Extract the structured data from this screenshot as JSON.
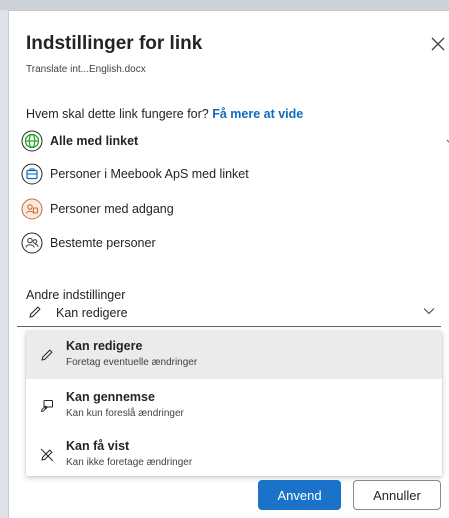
{
  "dialog": {
    "title": "Indstillinger for link",
    "filename": "Translate int...English.docx",
    "close_icon": "close-icon"
  },
  "audience": {
    "question": "Hvem skal dette link fungere for?",
    "learn_more": "Få mere at vide",
    "selected": "Alle med linket",
    "options": [
      {
        "label": "Alle med linket",
        "icon": "globe-icon",
        "icon_color": "#13a10e"
      },
      {
        "label": "Personer i Meebook ApS med linket",
        "icon": "building-icon",
        "icon_color": "#0f6cbd"
      },
      {
        "label": "Personer med adgang",
        "icon": "people-access-icon",
        "icon_color": "#c4733e"
      },
      {
        "label": "Bestemte personer",
        "icon": "people-icon",
        "icon_color": "#424242"
      }
    ]
  },
  "other_settings": {
    "label": "Andre indstillinger",
    "permission_value": "Kan redigere"
  },
  "permission_menu": {
    "items": [
      {
        "title": "Kan redigere",
        "description": "Foretag eventuelle ændringer",
        "icon": "pencil-icon"
      },
      {
        "title": "Kan gennemse",
        "description": "Kan kun foreslå ændringer",
        "icon": "review-icon"
      },
      {
        "title": "Kan få vist",
        "description": "Kan ikke foretage ændringer",
        "icon": "no-edit-icon"
      }
    ],
    "selected": "Kan redigere"
  },
  "buttons": {
    "apply": "Anvend",
    "cancel": "Annuller"
  },
  "colors": {
    "accent": "#1a73c9",
    "link": "#0f6cbd"
  }
}
